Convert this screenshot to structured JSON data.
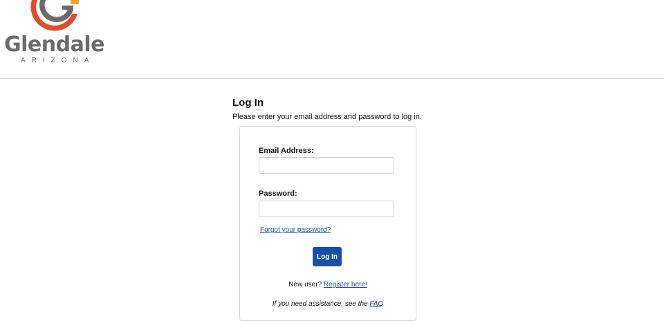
{
  "brand": {
    "name": "Glendale",
    "subtitle": "ARIZONA",
    "colors": {
      "orange": "#e8492b",
      "gray": "#6b6b6b",
      "accent_yellow": "#f5a623"
    }
  },
  "login": {
    "title": "Log In",
    "intro": "Please enter your email address and password to log in.",
    "email_label": "Email Address:",
    "email_value": "",
    "password_label": "Password:",
    "password_value": "",
    "forgot_link": "Forgot your password?",
    "submit_label": "Log In",
    "new_user_text": "New user?",
    "register_link": "Register here!",
    "assist_text": "If you need assistance, see the",
    "faq_link": "FAQ"
  },
  "colors": {
    "primary": "#1a4fa8",
    "border": "#d4d4d4"
  }
}
